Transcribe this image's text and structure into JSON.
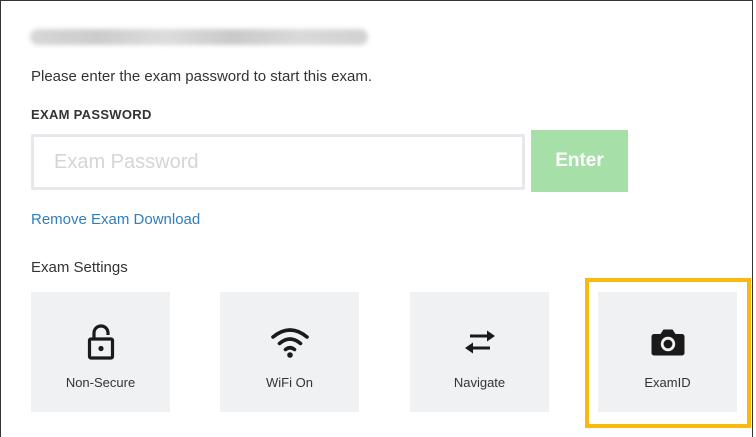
{
  "instruction": "Please enter the exam password to start this exam.",
  "password": {
    "label": "EXAM PASSWORD",
    "placeholder": "Exam Password",
    "value": ""
  },
  "enter_button": {
    "label": "Enter",
    "color": "#a7dfa8"
  },
  "remove_link": {
    "label": "Remove Exam Download",
    "color": "#2f7ebd"
  },
  "settings": {
    "label": "Exam Settings",
    "tiles": [
      {
        "label": "Non-Secure",
        "icon": "unlocked-padlock-icon"
      },
      {
        "label": "WiFi On",
        "icon": "wifi-icon"
      },
      {
        "label": "Navigate",
        "icon": "swap-arrows-icon"
      },
      {
        "label": "ExamID",
        "icon": "camera-icon",
        "highlighted": true
      }
    ]
  },
  "colors": {
    "highlight": "#fbb80f",
    "tile_background": "#f0f1f3",
    "text": "#333333"
  }
}
